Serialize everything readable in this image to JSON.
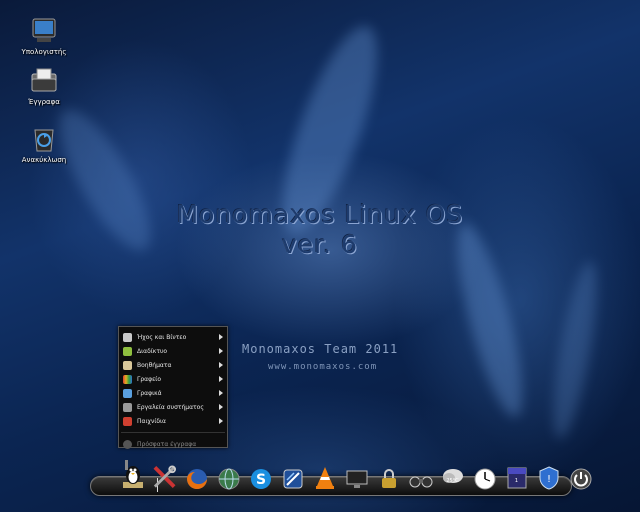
{
  "desktop": {
    "icons": [
      {
        "label": "Υπολογιστής",
        "icon": "computer-icon"
      },
      {
        "label": "Έγγραφα",
        "icon": "documents-folder-icon"
      },
      {
        "label": "Ανακύκλωση",
        "icon": "recycle-bin-icon"
      }
    ],
    "wallpaper": {
      "title_line1": "Monomaxos Linux OS",
      "title_line2": "ver. 6",
      "team": "Monomaxos Team 2011",
      "website": "www.monomaxos.com"
    }
  },
  "start_menu": {
    "items": [
      {
        "label": "Ήχος και Βίντεο",
        "icon": "multimedia-icon",
        "color": "#c9c9c9"
      },
      {
        "label": "Διαδίκτυο",
        "icon": "internet-icon",
        "color": "#8fbf3f"
      },
      {
        "label": "Βοηθήματα",
        "icon": "accessories-icon",
        "color": "#d9c79a"
      },
      {
        "label": "Γραφείο",
        "icon": "office-icon",
        "color": "#e0b020"
      },
      {
        "label": "Γραφικά",
        "icon": "graphics-icon",
        "color": "#5aa0e0"
      },
      {
        "label": "Εργαλεία συστήματος",
        "icon": "system-tools-icon",
        "color": "#9a9a9a"
      },
      {
        "label": "Παιχνίδια",
        "icon": "games-icon",
        "color": "#d04030"
      }
    ],
    "recent": {
      "label": "Πρόσφατα έγγραφα",
      "icon": "recent-documents-icon"
    }
  },
  "dock": {
    "items": [
      {
        "name": "menu-penguin-icon"
      },
      {
        "name": "settings-tools-icon"
      },
      {
        "name": "firefox-icon"
      },
      {
        "name": "network-globe-icon"
      },
      {
        "name": "skype-icon"
      },
      {
        "name": "office-writer-icon"
      },
      {
        "name": "vlc-icon"
      },
      {
        "name": "monitor-icon"
      },
      {
        "name": "lock-icon"
      },
      {
        "name": "binoculars-icon"
      },
      {
        "name": "weather-icon",
        "text": "25°C"
      },
      {
        "name": "clock-icon"
      },
      {
        "name": "calendar-icon",
        "text": "1"
      },
      {
        "name": "shield-icon"
      },
      {
        "name": "power-icon"
      }
    ]
  }
}
